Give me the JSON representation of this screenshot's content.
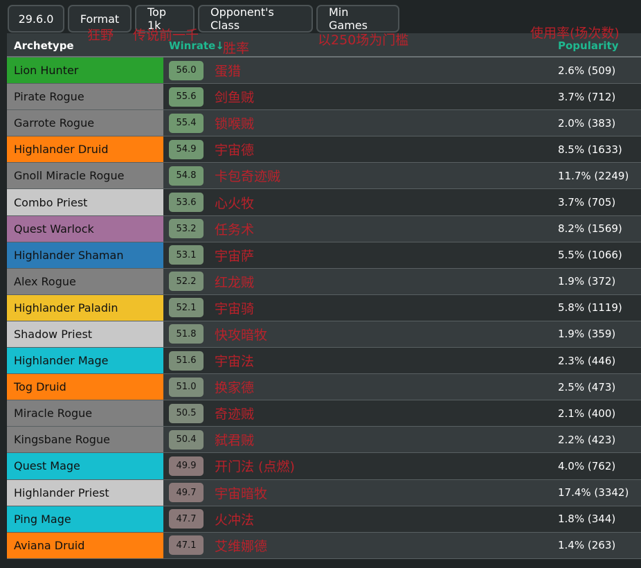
{
  "toolbar": [
    "29.6.0",
    "Format",
    "Top 1k",
    "Opponent's Class",
    "Min Games"
  ],
  "headers": {
    "archetype": "Archetype",
    "winrate": "Winrate↓",
    "popularity": "Popularity"
  },
  "annotations": {
    "format": "狂野",
    "top": "传说前一千",
    "winrate": "胜率",
    "min_games": "以250场为门槛",
    "popularity": "使用率(场次数)"
  },
  "rows": [
    {
      "name": "Lion Hunter",
      "color": "#2aa12f",
      "winrate": "56.0",
      "popularity": "2.6% (509)",
      "note": "蛋猎"
    },
    {
      "name": "Pirate Rogue",
      "color": "#808080",
      "winrate": "55.6",
      "popularity": "3.7% (712)",
      "note": "剑鱼贼"
    },
    {
      "name": "Garrote Rogue",
      "color": "#808080",
      "winrate": "55.4",
      "popularity": "2.0% (383)",
      "note": "锁喉贼"
    },
    {
      "name": "Highlander Druid",
      "color": "#ff7f0e",
      "winrate": "54.9",
      "popularity": "8.5% (1633)",
      "note": "宇宙德"
    },
    {
      "name": "Gnoll Miracle Rogue",
      "color": "#808080",
      "winrate": "54.8",
      "popularity": "11.7% (2249)",
      "note": "卡包奇迹贼"
    },
    {
      "name": "Combo Priest",
      "color": "#c8c8c8",
      "winrate": "53.6",
      "popularity": "3.7% (705)",
      "note": "心火牧"
    },
    {
      "name": "Quest Warlock",
      "color": "#a36f9b",
      "winrate": "53.2",
      "popularity": "8.2% (1569)",
      "note": "任务术"
    },
    {
      "name": "Highlander Shaman",
      "color": "#2c7bb6",
      "winrate": "53.1",
      "popularity": "5.5% (1066)",
      "note": "宇宙萨"
    },
    {
      "name": "Alex Rogue",
      "color": "#808080",
      "winrate": "52.2",
      "popularity": "1.9% (372)",
      "note": "红龙贼"
    },
    {
      "name": "Highlander Paladin",
      "color": "#f0c02a",
      "winrate": "52.1",
      "popularity": "5.8% (1119)",
      "note": "宇宙骑"
    },
    {
      "name": "Shadow Priest",
      "color": "#c8c8c8",
      "winrate": "51.8",
      "popularity": "1.9% (359)",
      "note": "快攻暗牧"
    },
    {
      "name": "Highlander Mage",
      "color": "#17becf",
      "winrate": "51.6",
      "popularity": "2.3% (446)",
      "note": "宇宙法"
    },
    {
      "name": "Tog Druid",
      "color": "#ff7f0e",
      "winrate": "51.0",
      "popularity": "2.5% (473)",
      "note": "换家德"
    },
    {
      "name": "Miracle Rogue",
      "color": "#808080",
      "winrate": "50.5",
      "popularity": "2.1% (400)",
      "note": "奇迹贼"
    },
    {
      "name": "Kingsbane Rogue",
      "color": "#808080",
      "winrate": "50.4",
      "popularity": "2.2% (423)",
      "note": "弑君贼"
    },
    {
      "name": "Quest Mage",
      "color": "#17becf",
      "winrate": "49.9",
      "popularity": "4.0% (762)",
      "note": "开门法 (点燃)"
    },
    {
      "name": "Highlander Priest",
      "color": "#c8c8c8",
      "winrate": "49.7",
      "popularity": "17.4% (3342)",
      "note": "宇宙暗牧"
    },
    {
      "name": "Ping Mage",
      "color": "#17becf",
      "winrate": "47.7",
      "popularity": "1.8% (344)",
      "note": "火冲法"
    },
    {
      "name": "Aviana Druid",
      "color": "#ff7f0e",
      "winrate": "47.1",
      "popularity": "1.4% (263)",
      "note": "艾维娜德"
    }
  ]
}
